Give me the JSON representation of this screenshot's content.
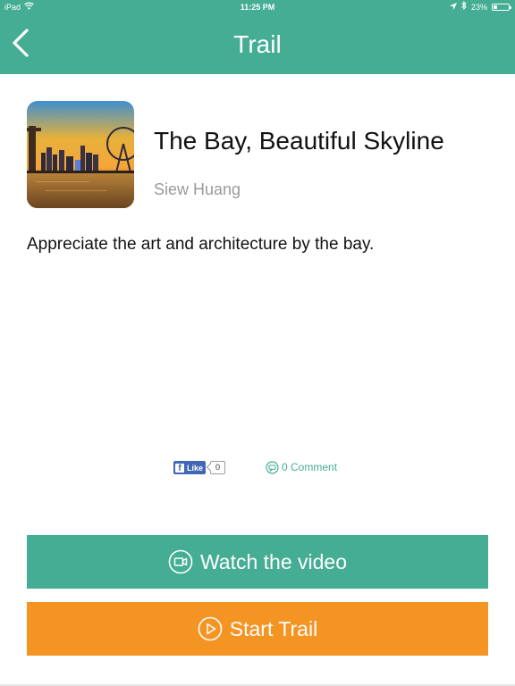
{
  "status_bar": {
    "device": "iPad",
    "time": "11:25 PM",
    "battery": "23%",
    "battery_level": 0.23
  },
  "nav": {
    "title": "Trail",
    "back_icon": "chevron-left-icon"
  },
  "trail": {
    "title": "The Bay, Beautiful Skyline",
    "author": "Siew Huang",
    "description": "Appreciate the art and architecture by the bay.",
    "thumbnail": "bay-skyline-photo"
  },
  "social": {
    "like_label": "Like",
    "like_count": "0",
    "comment_label": "0 Comment"
  },
  "buttons": {
    "watch_label": "Watch the video",
    "start_label": "Start Trail"
  },
  "colors": {
    "primary": "#45ad94",
    "accent": "#f49423",
    "facebook": "#4267b2"
  }
}
